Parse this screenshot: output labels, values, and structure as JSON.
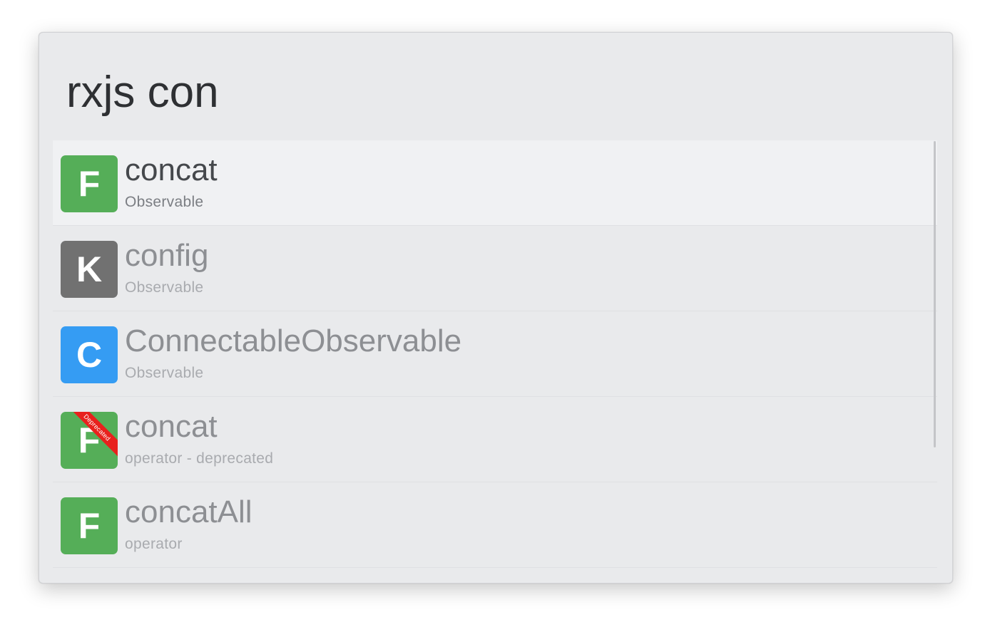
{
  "search": {
    "query": "rxjs con"
  },
  "results": [
    {
      "badge": "F",
      "badge_color": "#55ae58",
      "title": "concat",
      "subtitle": "Observable",
      "selected": true,
      "ribbon": ""
    },
    {
      "badge": "K",
      "badge_color": "#717171",
      "title": "config",
      "subtitle": "Observable",
      "selected": false,
      "ribbon": ""
    },
    {
      "badge": "C",
      "badge_color": "#359cf3",
      "title": "ConnectableObservable",
      "subtitle": "Observable",
      "selected": false,
      "ribbon": ""
    },
    {
      "badge": "F",
      "badge_color": "#55ae58",
      "title": "concat",
      "subtitle": "operator - deprecated",
      "selected": false,
      "ribbon": "Deprecated"
    },
    {
      "badge": "F",
      "badge_color": "#55ae58",
      "title": "concatAll",
      "subtitle": "operator",
      "selected": false,
      "ribbon": ""
    }
  ]
}
